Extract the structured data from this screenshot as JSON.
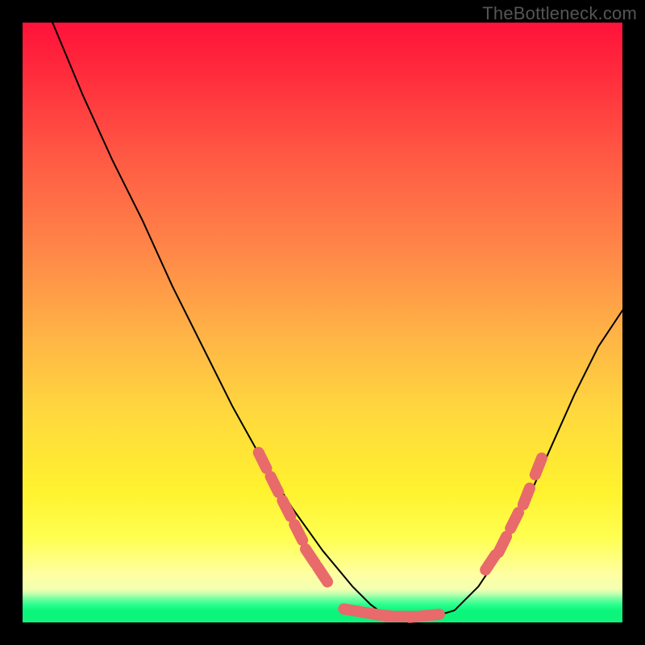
{
  "watermark": "TheBottleneck.com",
  "chart_data": {
    "type": "line",
    "title": "",
    "xlabel": "",
    "ylabel": "",
    "xlim": [
      0,
      100
    ],
    "ylim": [
      0,
      100
    ],
    "series": [
      {
        "name": "bottleneck-curve",
        "x": [
          5,
          10,
          15,
          20,
          25,
          30,
          35,
          40,
          45,
          50,
          55,
          58,
          60,
          62,
          64,
          66,
          68,
          72,
          76,
          80,
          84,
          88,
          92,
          96,
          100
        ],
        "values": [
          100,
          88,
          77,
          67,
          56,
          46,
          36,
          27,
          19,
          12,
          6,
          3,
          1.5,
          0.8,
          0.5,
          0.5,
          0.8,
          2,
          6,
          12,
          20,
          29,
          38,
          46,
          52
        ]
      }
    ],
    "markers": [
      {
        "name": "left-cluster",
        "x": [
          40,
          42,
          44,
          46,
          48,
          50
        ],
        "y": [
          27,
          23,
          19,
          15,
          11,
          8
        ]
      },
      {
        "name": "floor-cluster",
        "x": [
          55,
          58,
          60,
          62,
          64,
          66,
          68
        ],
        "y": [
          2,
          1.5,
          1.2,
          1,
          1,
          1,
          1.2
        ]
      },
      {
        "name": "right-cluster",
        "x": [
          78,
          80,
          82,
          84,
          86
        ],
        "y": [
          10,
          13,
          17,
          21,
          26
        ]
      }
    ],
    "gradient_stops": [
      {
        "pos": 0,
        "color": "#ff123a"
      },
      {
        "pos": 50,
        "color": "#ffb346"
      },
      {
        "pos": 80,
        "color": "#fff22e"
      },
      {
        "pos": 96,
        "color": "#2dff8f"
      },
      {
        "pos": 100,
        "color": "#0df57b"
      }
    ]
  }
}
